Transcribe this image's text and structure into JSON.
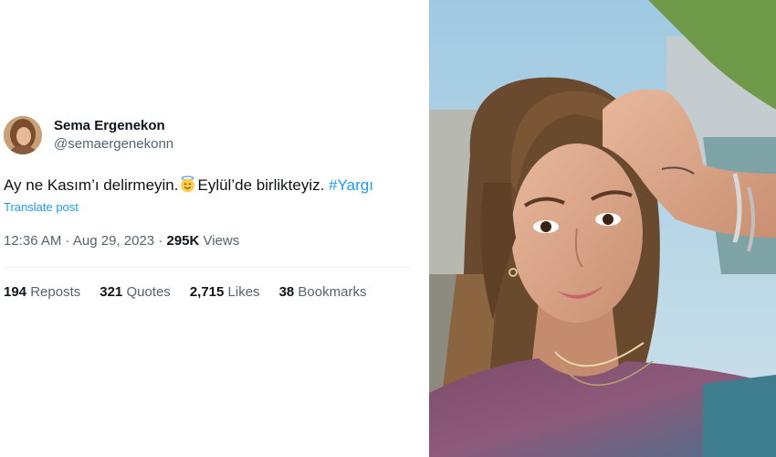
{
  "tweet": {
    "author": {
      "display_name": "Sema Ergenekon",
      "handle": "@semaergenekonn"
    },
    "text_before_emoji": "Ay ne Kasım’ı delirmeyin.",
    "emoji": "smiling-face-with-halo",
    "text_after_emoji": "Eylül’de birlikteyiz. ",
    "hashtag": "#Yargı",
    "translate_label": "Translate post",
    "time": "12:36 AM",
    "date": "Aug 29, 2023",
    "separator": " · ",
    "views_count": "295K",
    "views_label": " Views",
    "stats": {
      "reposts_count": "194",
      "reposts_label": "Reposts",
      "quotes_count": "321",
      "quotes_label": "Quotes",
      "likes_count": "2,715",
      "likes_label": "Likes",
      "bookmarks_count": "38",
      "bookmarks_label": "Bookmarks"
    }
  },
  "colors": {
    "link": "#1d9bf0",
    "secondary_text": "#536471",
    "primary_text": "#0f1419"
  }
}
